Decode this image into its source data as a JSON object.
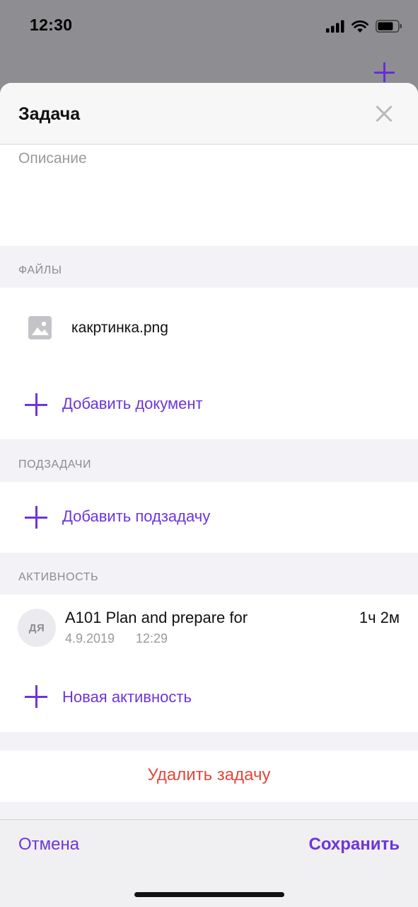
{
  "status_bar": {
    "time": "12:30",
    "icons": [
      "signal-icon",
      "wifi-icon",
      "battery-icon"
    ]
  },
  "sheet": {
    "title": "Задача",
    "description_placeholder": "Описание"
  },
  "files": {
    "section_label": "ФАЙЛЫ",
    "items": [
      {
        "name": "какртинка.png",
        "icon": "image-file-icon"
      }
    ],
    "add_label": "Добавить документ"
  },
  "subtasks": {
    "section_label": "ПОДЗАДАЧИ",
    "add_label": "Добавить подзадачу"
  },
  "activity": {
    "section_label": "АКТИВНОСТЬ",
    "items": [
      {
        "avatar": "ДЯ",
        "title": "A101 Plan and prepare for",
        "duration": "1ч 2м",
        "date": "4.9.2019",
        "time": "12:29"
      }
    ],
    "add_label": "Новая активность"
  },
  "delete_label": "Удалить задачу",
  "footer": {
    "cancel_label": "Отмена",
    "save_label": "Сохранить"
  },
  "colors": {
    "accent": "#6e35dc",
    "danger": "#e5463a",
    "secondary_text": "#8b8b90",
    "group_background": "#f2f2f7"
  }
}
